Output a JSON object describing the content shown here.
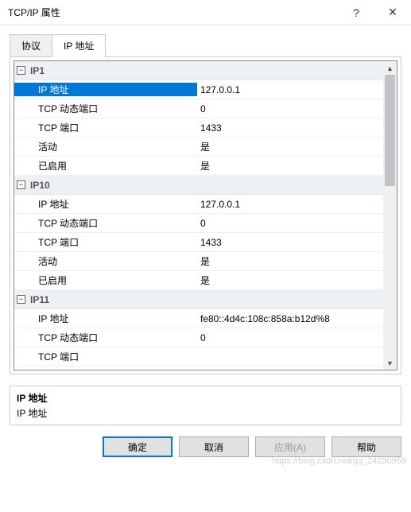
{
  "window": {
    "title": "TCP/IP 属性",
    "help": "?",
    "close": "✕"
  },
  "tabs": {
    "protocol": "协议",
    "ipaddr": "IP 地址"
  },
  "groups": [
    {
      "name": "IP1",
      "rows": [
        {
          "label": "IP 地址",
          "value": "127.0.0.1",
          "selected": true
        },
        {
          "label": "TCP 动态端口",
          "value": "0"
        },
        {
          "label": "TCP 端口",
          "value": "1433"
        },
        {
          "label": "活动",
          "value": "是"
        },
        {
          "label": "已启用",
          "value": "是"
        }
      ]
    },
    {
      "name": "IP10",
      "rows": [
        {
          "label": "IP 地址",
          "value": "127.0.0.1"
        },
        {
          "label": "TCP 动态端口",
          "value": "0"
        },
        {
          "label": "TCP 端口",
          "value": "1433"
        },
        {
          "label": "活动",
          "value": "是"
        },
        {
          "label": "已启用",
          "value": "是"
        }
      ]
    },
    {
      "name": "IP11",
      "rows": [
        {
          "label": "IP 地址",
          "value": "fe80::4d4c:108c:858a:b12d%8"
        },
        {
          "label": "TCP 动态端口",
          "value": "0"
        },
        {
          "label": "TCP 端口",
          "value": ""
        }
      ]
    }
  ],
  "description": {
    "title": "IP 地址",
    "text": "IP 地址"
  },
  "buttons": {
    "ok": "确定",
    "cancel": "取消",
    "apply": "应用(A)",
    "help": "帮助"
  },
  "expand_glyph": "⊟",
  "watermark": "https://blog.csdn.net/qq_24230959"
}
